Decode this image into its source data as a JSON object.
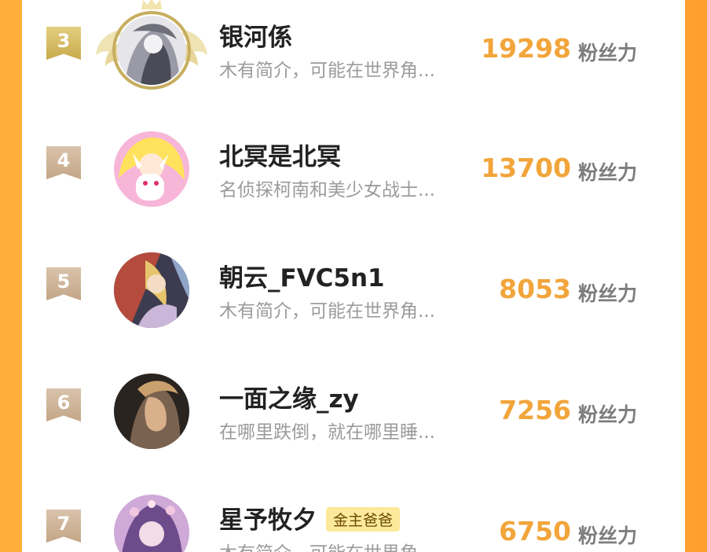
{
  "score_unit": "粉丝力",
  "rows": [
    {
      "rank": "3",
      "name": "银河係",
      "badge": "",
      "bio": "木有简介，可能在世界角...",
      "score": "19298",
      "top3": true,
      "avatar_colors": [
        "#e6e6ea",
        "#9a9aa6",
        "#4b4b58"
      ]
    },
    {
      "rank": "4",
      "name": "北冥是北冥",
      "badge": "",
      "bio": "名侦探柯南和美少女战士...",
      "score": "13700",
      "top3": false,
      "avatar_colors": [
        "#f7b6d8",
        "#ffe25c",
        "#ffffff"
      ]
    },
    {
      "rank": "5",
      "name": "朝云_FVC5n1",
      "badge": "",
      "bio": "木有简介，可能在世界角...",
      "score": "8053",
      "top3": false,
      "avatar_colors": [
        "#b44b3c",
        "#e6c56c",
        "#3d3b4f"
      ]
    },
    {
      "rank": "6",
      "name": "一面之缘_zy",
      "badge": "",
      "bio": "在哪里跌倒，就在哪里睡...",
      "score": "7256",
      "top3": false,
      "avatar_colors": [
        "#2a2420",
        "#7a6250",
        "#d8b08a"
      ]
    },
    {
      "rank": "7",
      "name": "星予牧夕",
      "badge": "金主爸爸",
      "bio": "木有简介，可能在世界角...",
      "score": "6750",
      "top3": false,
      "avatar_colors": [
        "#cfa9d8",
        "#6e4c8c",
        "#f1dce8"
      ]
    }
  ],
  "colors": {
    "score": "#f2a53b",
    "rank_gold": "#c9a94c",
    "rank_bronze": "#c4a687",
    "badge_bg": "#fde99a",
    "background_orange": "#ffae3a"
  }
}
